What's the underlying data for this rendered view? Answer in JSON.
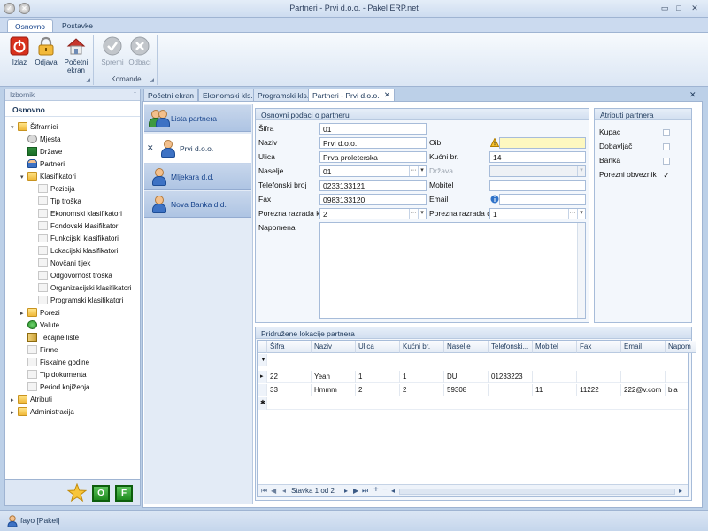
{
  "window": {
    "title": "Partneri - Prvi d.o.o. - Pakel ERP.net"
  },
  "ribbon": {
    "tabs": [
      "Osnovno",
      "Postavke"
    ],
    "buttons": {
      "izlaz": "Izlaz",
      "odjava": "Odjava",
      "pocetni1": "Početni",
      "pocetni2": "ekran",
      "spremi": "Spremi",
      "odbaci": "Odbaci"
    },
    "group_komande": "Komande"
  },
  "leftpanel": {
    "header": "Izbornik",
    "subheader": "Osnovno",
    "tree": [
      {
        "label": "Šifrarnici"
      },
      {
        "label": "Mjesta"
      },
      {
        "label": "Države"
      },
      {
        "label": "Partneri"
      },
      {
        "label": "Klasifikatori"
      },
      {
        "label": "Pozicija"
      },
      {
        "label": "Tip troška"
      },
      {
        "label": "Ekonomski klasifikatori"
      },
      {
        "label": "Fondovski klasifikatori"
      },
      {
        "label": "Funkcijski klasifikatori"
      },
      {
        "label": "Lokacijski klasifikatori"
      },
      {
        "label": "Novčani tijek"
      },
      {
        "label": "Odgovornost troška"
      },
      {
        "label": "Organizacijski klasifikatori"
      },
      {
        "label": "Programski klasifikatori"
      },
      {
        "label": "Porezi"
      },
      {
        "label": "Valute"
      },
      {
        "label": "Tečajne liste"
      },
      {
        "label": "Firme"
      },
      {
        "label": "Fiskalne godine"
      },
      {
        "label": "Tip dokumenta"
      },
      {
        "label": "Period knjiženja"
      },
      {
        "label": "Atributi"
      },
      {
        "label": "Administracija"
      }
    ],
    "buttons": {
      "o": "O",
      "f": "F"
    }
  },
  "doctabs": [
    "Početni ekran",
    "Ekonomski kls.",
    "Programski kls.",
    "Partneri - Prvi d.o.o."
  ],
  "nav": {
    "header": "Lista partnera",
    "items": [
      "Prvi d.o.o.",
      "Mljekara d.d.",
      "Nova Banka d.d."
    ]
  },
  "form": {
    "title": "Osnovni podaci o partneru",
    "labels": {
      "sifra": "Šifra",
      "naziv": "Naziv",
      "ulica": "Ulica",
      "naselje": "Naselje",
      "telefon": "Telefonski broj",
      "fax": "Fax",
      "porezna_k": "Porezna razrada k.",
      "napomena": "Napomena",
      "oib": "Oib",
      "kucni": "Kućni br.",
      "drzava": "Država",
      "mobitel": "Mobitel",
      "email": "Email",
      "porezna_d": "Porezna razrada d."
    },
    "values": {
      "sifra": "01",
      "naziv": "Prvi d.o.o.",
      "ulica": "Prva proleterska",
      "naselje": "01",
      "telefon": "0233133121",
      "fax": "0983133120",
      "porezna_k": "2",
      "oib": "",
      "kucni": "14",
      "drzava": "",
      "mobitel": "",
      "email": "",
      "porezna_d": "1"
    }
  },
  "attributes": {
    "title": "Atributi partnera",
    "items": [
      {
        "label": "Kupac",
        "checked": false
      },
      {
        "label": "Dobavljač",
        "checked": false
      },
      {
        "label": "Banka",
        "checked": false
      },
      {
        "label": "Porezni obveznik",
        "checked": true
      }
    ]
  },
  "locations": {
    "title": "Pridružene lokacije partnera",
    "columns": [
      "Šifra",
      "Naziv",
      "Ulica",
      "Kućni br.",
      "Naselje",
      "Telefonski...",
      "Mobitel",
      "Fax",
      "Email",
      "Napom"
    ],
    "rows": [
      [
        "22",
        "Yeah",
        "1",
        "1",
        "DU",
        "01233223",
        "",
        "",
        "",
        ""
      ],
      [
        "33",
        "Hmmm",
        "2",
        "2",
        "59308",
        "",
        "11",
        "11222",
        "222@v.com",
        "bla"
      ]
    ],
    "pager": "Stavka 1 od 2"
  },
  "status": {
    "user": "fayo [Pakel]"
  },
  "colors": {
    "accent": "#15428b",
    "ribbon_bg": "#dbe6f4",
    "green_button": "#1f8b1f",
    "close_red": "#d8311d"
  }
}
